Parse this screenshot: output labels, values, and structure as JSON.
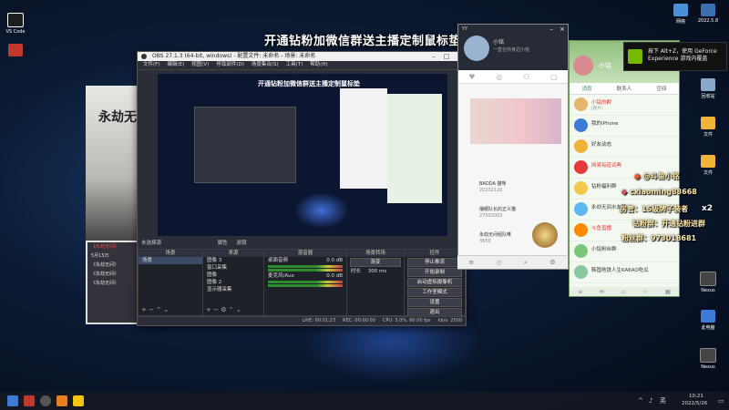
{
  "desktop": {
    "icons_left": [
      {
        "label": "VS Code",
        "color": "#ffffff"
      },
      {
        "label": "",
        "color": "#c0392b"
      }
    ],
    "icons_right": [
      {
        "label": "2022.5.8",
        "color": "#3a6fb0"
      },
      {
        "label": "网络",
        "color": "#4a90d9"
      },
      {
        "label": "回收站",
        "color": "#8ba8c8"
      },
      {
        "label": "文件",
        "color": "#f0b33a"
      },
      {
        "label": "文件",
        "color": "#f0b33a"
      },
      {
        "label": "Nexus",
        "color": "#444444"
      },
      {
        "label": "此电脑",
        "color": "#3d7bd6"
      },
      {
        "label": "Nexus",
        "color": "#444444"
      }
    ]
  },
  "headline": "开通钻粉加微信群送主播定制鼠标垫",
  "obs": {
    "title": "OBS 27.1.3 (64-bit, windows) - 配置文件: 未命名 - 场景: 未命名",
    "menu": [
      "文件(F)",
      "编辑(E)",
      "视图(V)",
      "停靠部件(D)",
      "场景集合(S)",
      "工具(T)",
      "帮助(H)"
    ],
    "preview_headline": "开通钻粉加微信群送主播定制鼠标垫",
    "source_selector": [
      "未选择源",
      "属性",
      "滤镜"
    ],
    "panels": {
      "scenes": {
        "title": "场景",
        "items": [
          "场景"
        ]
      },
      "sources": {
        "title": "来源",
        "items": [
          "图像 3",
          "窗口采集",
          "图像",
          "图像 2",
          "显示器采集"
        ]
      },
      "mixer": {
        "title": "混音器",
        "channels": [
          {
            "name": "桌面音频",
            "level": "0.0 dB"
          },
          {
            "name": "麦克风/Aux",
            "level": "0.0 dB"
          }
        ]
      },
      "transitions": {
        "title": "场景转场",
        "type": "渐变",
        "duration_label": "时长",
        "duration": "300 ms"
      },
      "controls": {
        "title": "控件",
        "buttons": [
          "停止推流",
          "开始录制",
          "启动虚拟摄像机",
          "工作室模式",
          "设置",
          "退出"
        ]
      }
    },
    "status": {
      "live": "LIVE: 00:01:23",
      "rec": "REC: 00:00:00",
      "cpu": "CPU: 3.0%, 60.00 fps",
      "kbps": "kb/s: 2500"
    }
  },
  "game": {
    "title": "永劫无间",
    "news": [
      "【永劫无间】",
      "5月15日",
      "《永劫无间》",
      "《永劫无间》",
      "《永劫无间》"
    ]
  },
  "yy": {
    "title": "YY",
    "nick": "小铭",
    "sub": "一直在你身边小铭",
    "tabs": [
      "♥",
      "◎",
      "⚇",
      "▢"
    ],
    "entries": [
      {
        "name": "BADDA 猫咪",
        "stat": "20232120"
      },
      {
        "name": "播眼队长的正义猫",
        "stat": "27502003"
      },
      {
        "name": "永劫无间组队唯",
        "stat": "3650"
      }
    ]
  },
  "qq": {
    "nick": "小铭",
    "tabs": [
      "消息",
      "联系人",
      "空间"
    ],
    "chats": [
      {
        "name": "小铭的群",
        "desc": "[图片]",
        "color": "#e6b46a",
        "red": true
      },
      {
        "name": "我的iPhone",
        "desc": "",
        "color": "#3d7bd6",
        "red": false
      },
      {
        "name": "好友动态",
        "desc": "",
        "color": "#f0b33a",
        "red": false
      },
      {
        "name": "网易有道词典",
        "desc": "",
        "color": "#e33a3a",
        "red": true
      },
      {
        "name": "钻粉福利群",
        "desc": "",
        "color": "#f2c94c",
        "red": false
      },
      {
        "name": "永劫无间水友群",
        "desc": "",
        "color": "#5fb8f0",
        "red": false
      },
      {
        "name": "斗鱼直播",
        "desc": "",
        "color": "#ff8a00",
        "red": true
      },
      {
        "name": "小铭粉丝群",
        "desc": "",
        "color": "#7bc67b",
        "red": false
      },
      {
        "name": "韩国地铁人生KAKAO吃瓜",
        "desc": "",
        "color": "#8ac7a1",
        "red": false
      }
    ]
  },
  "toast": {
    "message": "按下 Alt+Z，使用 GeForce Experience 游戏内覆盖"
  },
  "overlay": {
    "douyu": "@斗鱼小铭",
    "weibo": "cxiaoming88668",
    "rank": "房管：15级牌子装者",
    "multiplier": "x2",
    "fans": "钻粉群：开通钻粉进群",
    "qq_group": "粉丝群：973018681"
  },
  "taskbar": {
    "time": "10:21",
    "date": "2022/5/26",
    "lang": "英"
  }
}
